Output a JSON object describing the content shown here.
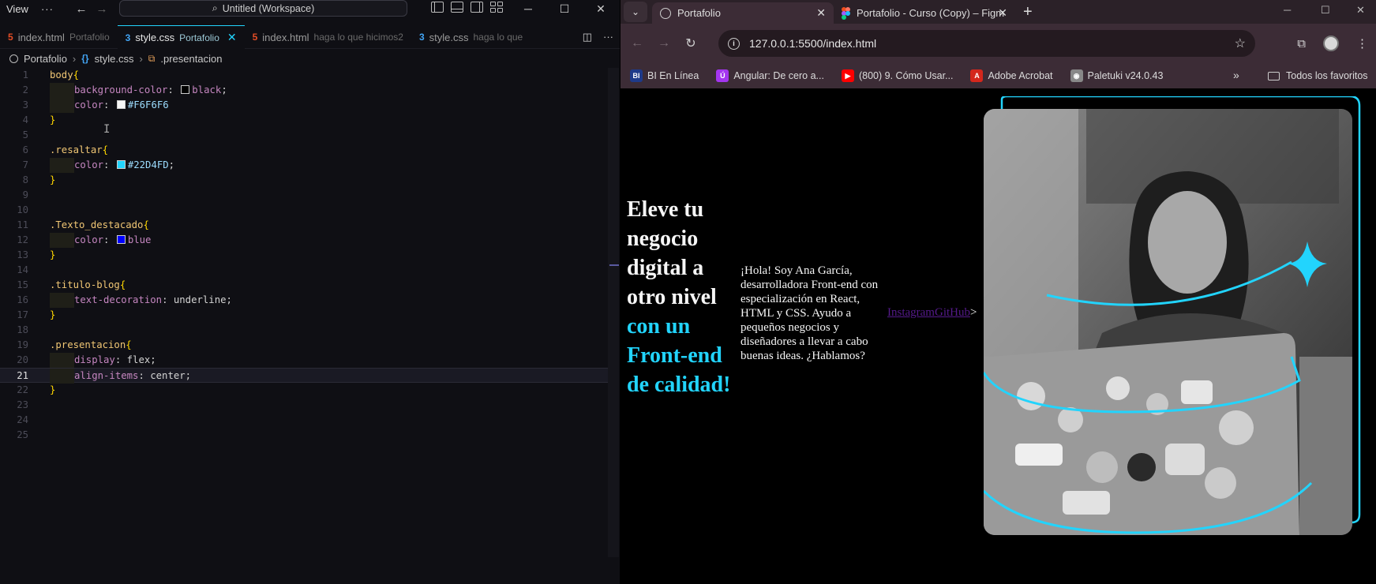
{
  "vscode": {
    "menu": "View",
    "search": "Untitled (Workspace)",
    "tabs": [
      {
        "name": "index.html",
        "sub": "Portafolio",
        "type": "html"
      },
      {
        "name": "style.css",
        "sub": "Portafolio",
        "type": "css",
        "active": true
      },
      {
        "name": "index.html",
        "sub": "haga lo que hicimos2",
        "type": "html"
      },
      {
        "name": "style.css",
        "sub": "haga lo que",
        "type": "css"
      }
    ],
    "breadcrumb": [
      "Portafolio",
      "style.css",
      ".presentacion"
    ],
    "current_line": 21,
    "code": [
      {
        "n": "1",
        "tokens": [
          [
            "sel",
            "body"
          ],
          [
            "brace",
            "{"
          ]
        ]
      },
      {
        "n": "2",
        "indent": 1,
        "tokens": [
          [
            "prop",
            "background-color"
          ],
          [
            "colon",
            ": "
          ],
          [
            "swatch",
            "#000000"
          ],
          [
            "val-kw",
            "black"
          ],
          [
            "colon",
            ";"
          ]
        ]
      },
      {
        "n": "3",
        "indent": 1,
        "tokens": [
          [
            "prop",
            "color"
          ],
          [
            "colon",
            ": "
          ],
          [
            "swatch",
            "#F6F6F6"
          ],
          [
            "val-hex",
            "#F6F6F6"
          ]
        ]
      },
      {
        "n": "4",
        "tokens": [
          [
            "brace",
            "}"
          ]
        ]
      },
      {
        "n": "5",
        "tokens": []
      },
      {
        "n": "6",
        "tokens": [
          [
            "sel",
            ".resaltar"
          ],
          [
            "brace",
            "{"
          ]
        ]
      },
      {
        "n": "7",
        "indent": 1,
        "tokens": [
          [
            "prop",
            "color"
          ],
          [
            "colon",
            ": "
          ],
          [
            "swatch",
            "#22D4FD"
          ],
          [
            "val-hex",
            "#22D4FD"
          ],
          [
            "colon",
            ";"
          ]
        ]
      },
      {
        "n": "8",
        "tokens": [
          [
            "brace",
            "}"
          ]
        ]
      },
      {
        "n": "9",
        "tokens": []
      },
      {
        "n": "10",
        "tokens": []
      },
      {
        "n": "11",
        "tokens": [
          [
            "sel",
            ".Texto_destacado"
          ],
          [
            "brace",
            "{"
          ]
        ]
      },
      {
        "n": "12",
        "indent": 1,
        "tokens": [
          [
            "prop",
            "color"
          ],
          [
            "colon",
            ": "
          ],
          [
            "swatch",
            "#0000FF"
          ],
          [
            "val-kw",
            "blue"
          ]
        ]
      },
      {
        "n": "13",
        "tokens": [
          [
            "brace",
            "}"
          ]
        ]
      },
      {
        "n": "14",
        "tokens": []
      },
      {
        "n": "15",
        "tokens": [
          [
            "sel",
            ".titulo-blog"
          ],
          [
            "brace",
            "{"
          ]
        ]
      },
      {
        "n": "16",
        "indent": 1,
        "tokens": [
          [
            "prop",
            "text-decoration"
          ],
          [
            "colon",
            ": "
          ],
          [
            "val",
            "underline"
          ],
          [
            "colon",
            ";"
          ]
        ]
      },
      {
        "n": "17",
        "tokens": [
          [
            "brace",
            "}"
          ]
        ]
      },
      {
        "n": "18",
        "tokens": []
      },
      {
        "n": "19",
        "tokens": [
          [
            "sel",
            ".presentacion"
          ],
          [
            "brace",
            "{"
          ]
        ]
      },
      {
        "n": "20",
        "indent": 1,
        "tokens": [
          [
            "prop",
            "display"
          ],
          [
            "colon",
            ": "
          ],
          [
            "val",
            "flex"
          ],
          [
            "colon",
            ";"
          ]
        ]
      },
      {
        "n": "21",
        "indent": 1,
        "tokens": [
          [
            "prop",
            "align-items"
          ],
          [
            "colon",
            ": "
          ],
          [
            "val",
            "center"
          ],
          [
            "colon",
            ";"
          ]
        ]
      },
      {
        "n": "22",
        "tokens": [
          [
            "brace",
            "}"
          ]
        ]
      },
      {
        "n": "23",
        "tokens": []
      },
      {
        "n": "24",
        "tokens": []
      },
      {
        "n": "25",
        "tokens": []
      }
    ]
  },
  "browser": {
    "tabs": [
      {
        "title": "Portafolio",
        "active": true
      },
      {
        "title": "Portafolio - Curso (Copy) – Figm",
        "active": false
      }
    ],
    "url": "127.0.0.1:5500/index.html",
    "bookmarks": [
      {
        "label": "BI En Línea",
        "icon": "BI",
        "color": "#1e3a8a"
      },
      {
        "label": "Angular: De cero a...",
        "icon": "Ú",
        "color": "#a435f0"
      },
      {
        "label": "(800) 9. Cómo Usar...",
        "icon": "▶",
        "color": "#ff0000"
      },
      {
        "label": "Adobe Acrobat",
        "icon": "A",
        "color": "#d4271c"
      },
      {
        "label": "Paletuki v24.0.43",
        "icon": "◉",
        "color": "#888888"
      }
    ],
    "all_favorites": "Todos los favoritos"
  },
  "page": {
    "title_main": "Eleve tu negocio digital a otro nivel",
    "title_highlight": "con un Front-end de calidad!",
    "description": "¡Hola! Soy Ana García, desarrolladora Front-end con especialización en React, HTML y CSS. Ayudo a pequeños negocios y diseñadores a llevar a cabo buenas ideas. ¿Hablamos?",
    "link_instagram": "Instagram",
    "link_github": "GitHub",
    "stray_gt": ">",
    "accent": "#22D4FD"
  }
}
